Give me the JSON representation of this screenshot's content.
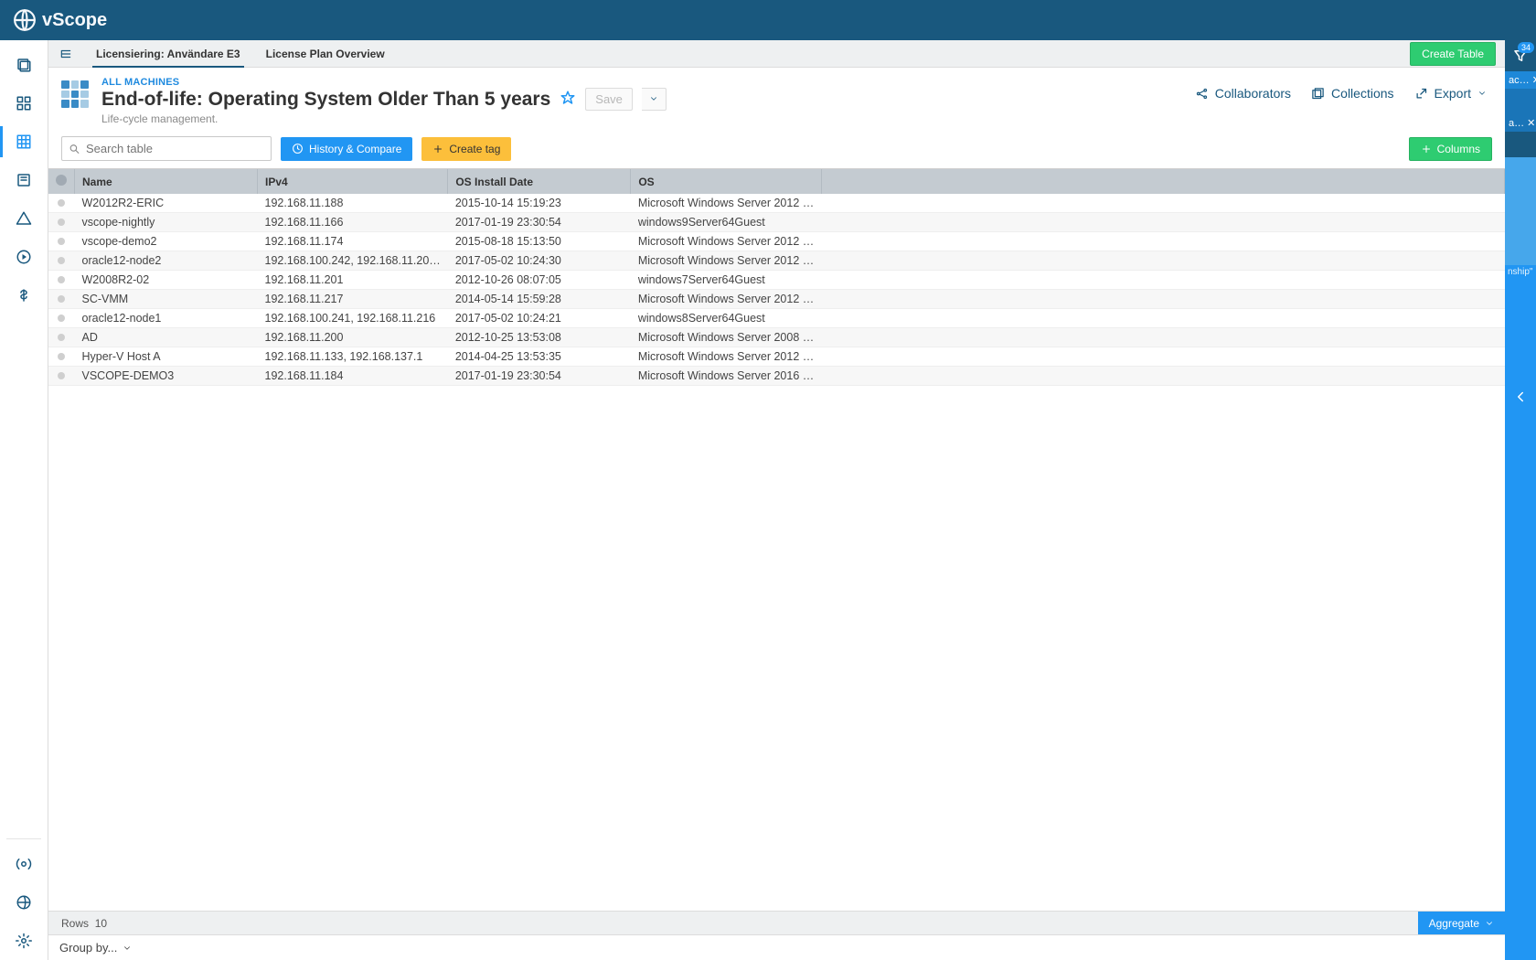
{
  "brand": "vScope",
  "tabs": {
    "left_label": "Licensiering: Användare E3",
    "right_label": "License Plan Overview"
  },
  "create_table_button": "Create Table",
  "breadcrumb": "ALL MACHINES",
  "page_title": "End-of-life: Operating System Older Than 5 years",
  "subtitle": "Life-cycle management.",
  "save_label": "Save",
  "header_actions": {
    "collaborators": "Collaborators",
    "collections": "Collections",
    "export": "Export"
  },
  "search_placeholder": "Search table",
  "toolbar": {
    "history_compare": "History & Compare",
    "create_tag": "Create tag",
    "columns": "Columns"
  },
  "columns": {
    "name": "Name",
    "ipv4": "IPv4",
    "os_install_date": "OS Install Date",
    "os": "OS"
  },
  "rows": [
    {
      "name": "W2012R2-ERIC",
      "ip": "192.168.11.188",
      "date": "2015-10-14 15:19:23",
      "os": "Microsoft Windows Server 2012 …"
    },
    {
      "name": "vscope-nightly",
      "ip": "192.168.11.166",
      "date": "2017-01-19 23:30:54",
      "os": "windows9Server64Guest"
    },
    {
      "name": "vscope-demo2",
      "ip": "192.168.11.174",
      "date": "2015-08-18 15:13:50",
      "os": "Microsoft Windows Server 2012 …"
    },
    {
      "name": "oracle12-node2",
      "ip": "192.168.100.242, 192.168.11.20…",
      "date": "2017-05-02 10:24:30",
      "os": "Microsoft Windows Server 2012 …"
    },
    {
      "name": "W2008R2-02",
      "ip": "192.168.11.201",
      "date": "2012-10-26 08:07:05",
      "os": "windows7Server64Guest"
    },
    {
      "name": "SC-VMM",
      "ip": "192.168.11.217",
      "date": "2014-05-14 15:59:28",
      "os": "Microsoft Windows Server 2012 …"
    },
    {
      "name": "oracle12-node1",
      "ip": "192.168.100.241, 192.168.11.216",
      "date": "2017-05-02 10:24:21",
      "os": "windows8Server64Guest"
    },
    {
      "name": "AD",
      "ip": "192.168.11.200",
      "date": "2012-10-25 13:53:08",
      "os": "Microsoft Windows Server 2008 …"
    },
    {
      "name": "Hyper-V Host A",
      "ip": "192.168.11.133, 192.168.137.1",
      "date": "2014-04-25 13:53:35",
      "os": "Microsoft Windows Server 2012 …"
    },
    {
      "name": "VSCOPE-DEMO3",
      "ip": "192.168.11.184",
      "date": "2017-01-19 23:30:54",
      "os": "Microsoft Windows Server 2016 …"
    }
  ],
  "footer": {
    "rows_label": "Rows",
    "rows_count": "10",
    "aggregate": "Aggregate",
    "group_by": "Group by..."
  },
  "filter_panel": {
    "badge": "34",
    "chip1": "ac…",
    "chip2": "a…",
    "quote": "nship\""
  }
}
